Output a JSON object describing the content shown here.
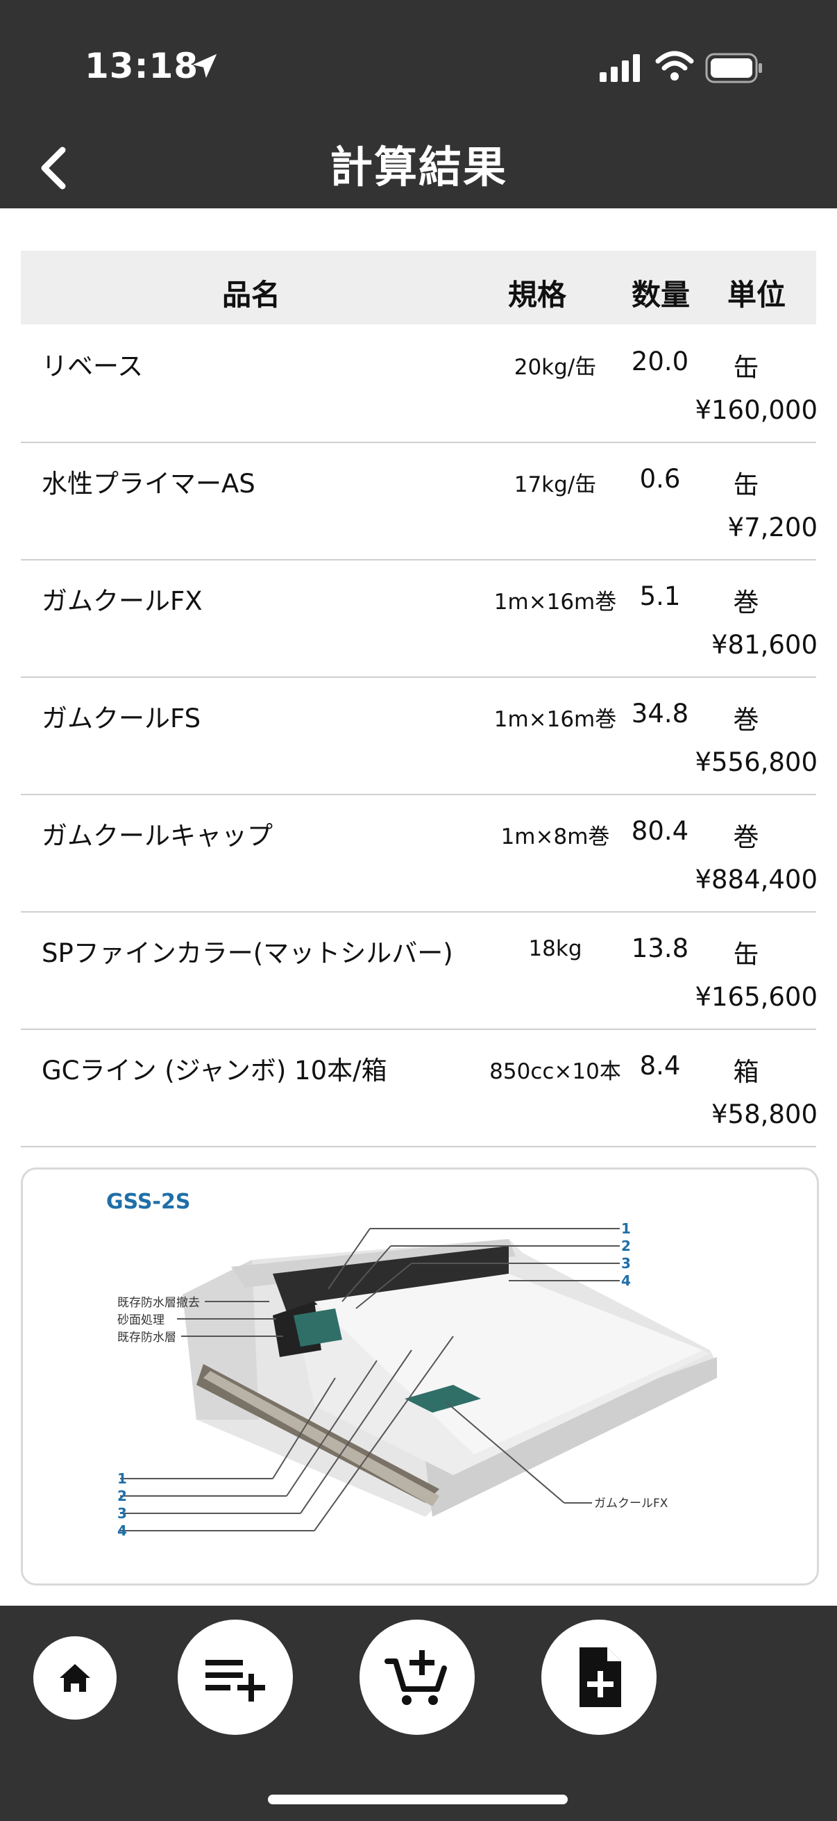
{
  "status": {
    "time": "13:18"
  },
  "header": {
    "title": "計算結果"
  },
  "table": {
    "headers": {
      "name": "品名",
      "spec": "規格",
      "qty": "数量",
      "unit": "単位"
    },
    "rows": [
      {
        "name": "リベース",
        "spec": "20kg/缶",
        "qty": "20.0",
        "unit": "缶",
        "price": "¥160,000"
      },
      {
        "name": "水性プライマーAS",
        "spec": "17kg/缶",
        "qty": "0.6",
        "unit": "缶",
        "price": "¥7,200"
      },
      {
        "name": "ガムクールFX",
        "spec": "1m×16m巻",
        "qty": "5.1",
        "unit": "巻",
        "price": "¥81,600"
      },
      {
        "name": "ガムクールFS",
        "spec": "1m×16m巻",
        "qty": "34.8",
        "unit": "巻",
        "price": "¥556,800"
      },
      {
        "name": "ガムクールキャップ",
        "spec": "1m×8m巻",
        "qty": "80.4",
        "unit": "巻",
        "price": "¥884,400"
      },
      {
        "name": "SPファインカラー(マットシルバー)",
        "spec": "18kg",
        "qty": "13.8",
        "unit": "缶",
        "price": "¥165,600"
      },
      {
        "name": "GCライン (ジャンボ) 10本/箱",
        "spec": "850cc×10本",
        "qty": "8.4",
        "unit": "箱",
        "price": "¥58,800"
      }
    ]
  },
  "diagram": {
    "system_name": "GSS-2S",
    "left_labels": [
      "既存防水層撤去",
      "砂面処理",
      "既存防水層"
    ],
    "top_numbers": [
      "1",
      "2",
      "3",
      "4"
    ],
    "bottom_numbers": [
      "1",
      "2",
      "3",
      "4"
    ],
    "callout": "ガムクールFX"
  },
  "bottom_nav": {
    "buttons": [
      "home-icon",
      "playlist-add-icon",
      "cart-add-icon",
      "file-add-icon"
    ]
  },
  "colors": {
    "bar": "#333333",
    "accent_blue": "#1f6fa8",
    "sheet_green": "#2f6f68"
  }
}
